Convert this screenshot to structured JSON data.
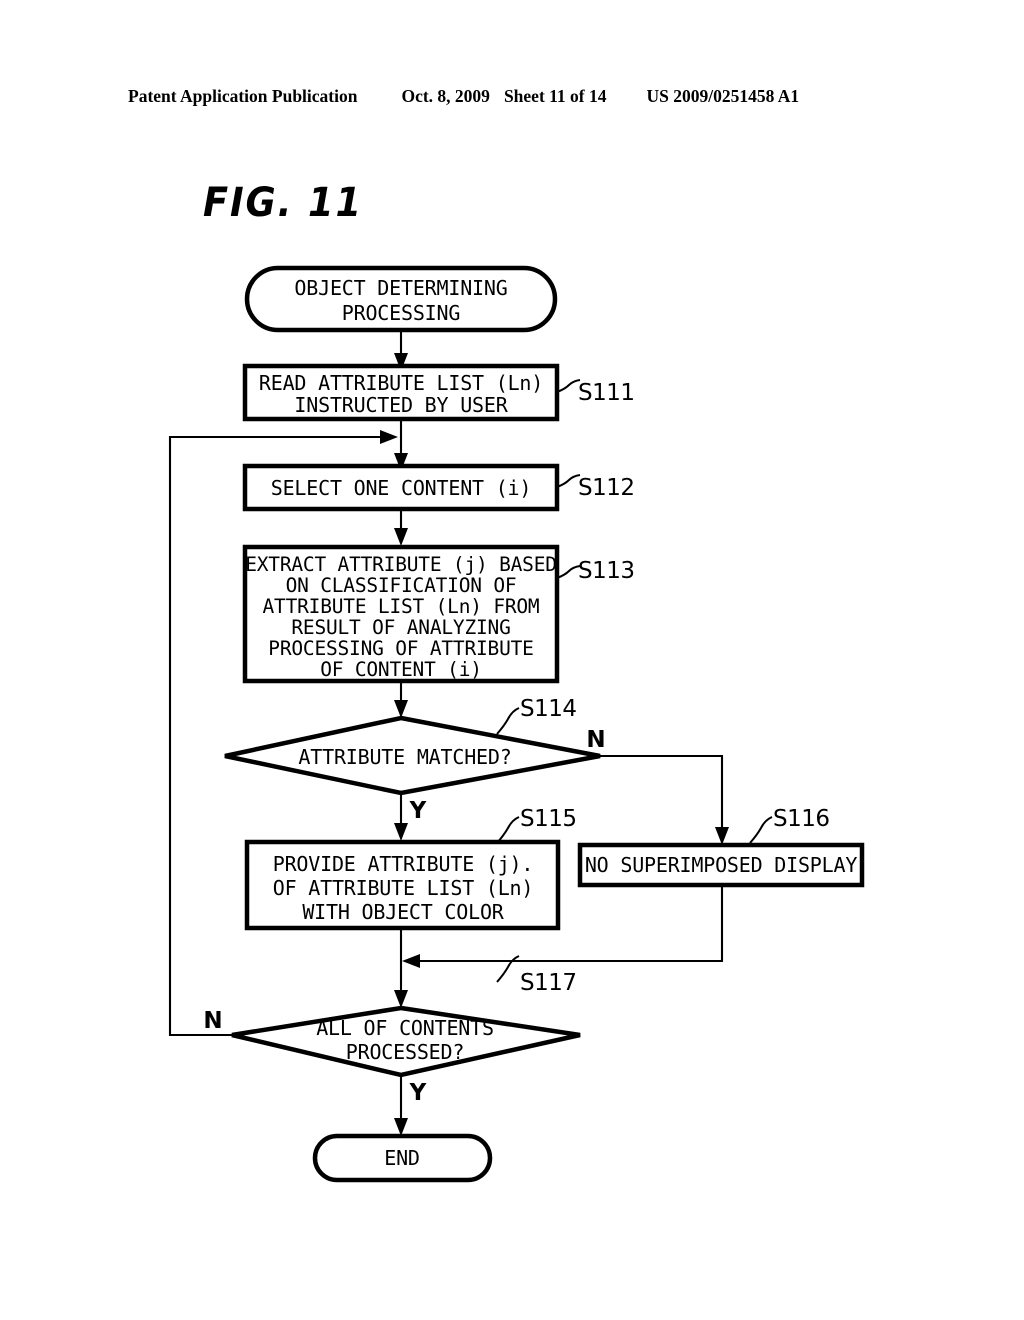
{
  "header": {
    "publication": "Patent Application Publication",
    "date": "Oct. 8, 2009",
    "sheet": "Sheet 11 of 14",
    "patent_number": "US 2009/0251458 A1"
  },
  "figure": {
    "label": "FIG. 11",
    "type": "flowchart",
    "title": "OBJECT DETERMINING PROCESSING"
  },
  "flowchart": {
    "start": {
      "shape": "terminal",
      "line1": "OBJECT DETERMINING",
      "line2": "PROCESSING"
    },
    "s111": {
      "step": "S111",
      "shape": "process",
      "line1": "READ ATTRIBUTE LIST (Ln)",
      "line2": "INSTRUCTED BY USER"
    },
    "s112": {
      "step": "S112",
      "shape": "process",
      "line1": "SELECT ONE CONTENT (i)"
    },
    "s113": {
      "step": "S113",
      "shape": "process",
      "line1": "EXTRACT ATTRIBUTE (j) BASED",
      "line2": "ON CLASSIFICATION OF",
      "line3": "ATTRIBUTE LIST (Ln) FROM",
      "line4": "RESULT OF ANALYZING",
      "line5": "PROCESSING OF ATTRIBUTE",
      "line6": "OF CONTENT (i)"
    },
    "s114": {
      "step": "S114",
      "shape": "decision",
      "line1": "ATTRIBUTE MATCHED?",
      "yes_label": "Y",
      "no_label": "N"
    },
    "s115": {
      "step": "S115",
      "shape": "process",
      "line1": "PROVIDE ATTRIBUTE (j).",
      "line2": "OF ATTRIBUTE LIST (Ln)",
      "line3": "WITH OBJECT COLOR"
    },
    "s116": {
      "step": "S116",
      "shape": "process",
      "line1": "NO SUPERIMPOSED DISPLAY"
    },
    "s117": {
      "step": "S117",
      "shape": "decision",
      "line1": "ALL OF CONTENTS",
      "line2": "PROCESSED?",
      "yes_label": "Y",
      "no_label": "N"
    },
    "end": {
      "shape": "terminal",
      "line1": "END"
    }
  },
  "colors": {
    "ink": "#000000",
    "paper": "#ffffff"
  }
}
